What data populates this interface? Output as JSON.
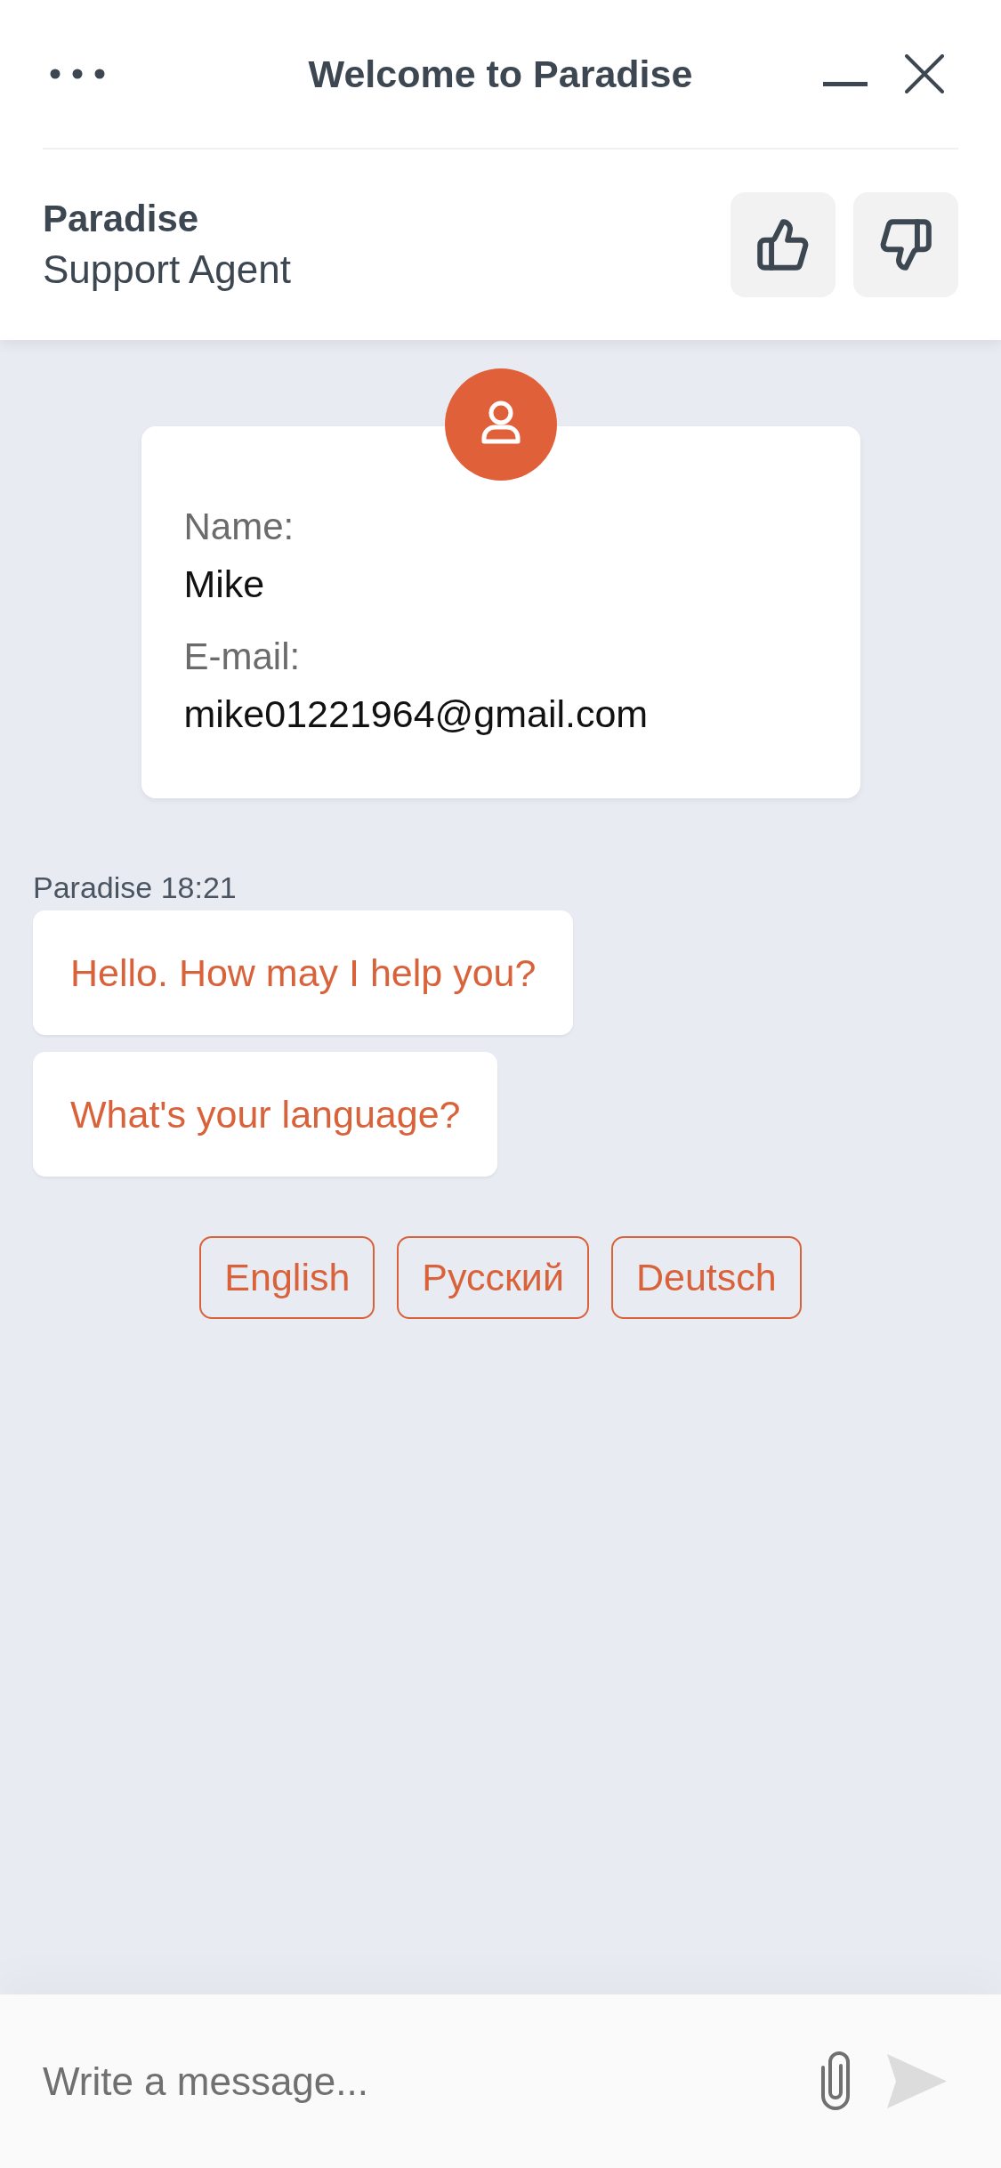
{
  "window": {
    "title": "Welcome to Paradise"
  },
  "agent": {
    "name": "Paradise",
    "role": "Support Agent"
  },
  "contact_card": {
    "fields": [
      {
        "label": "Name:",
        "value": "Mike"
      },
      {
        "label": "E-mail:",
        "value": "mike01221964@gmail.com"
      }
    ]
  },
  "conversation": {
    "meta": "Paradise 18:21",
    "messages": [
      "Hello. How may I help you?",
      "What's your language?"
    ]
  },
  "quick_replies": [
    "English",
    "Русский",
    "Deutsch"
  ],
  "composer": {
    "placeholder": "Write a message...",
    "send_disabled": true
  }
}
